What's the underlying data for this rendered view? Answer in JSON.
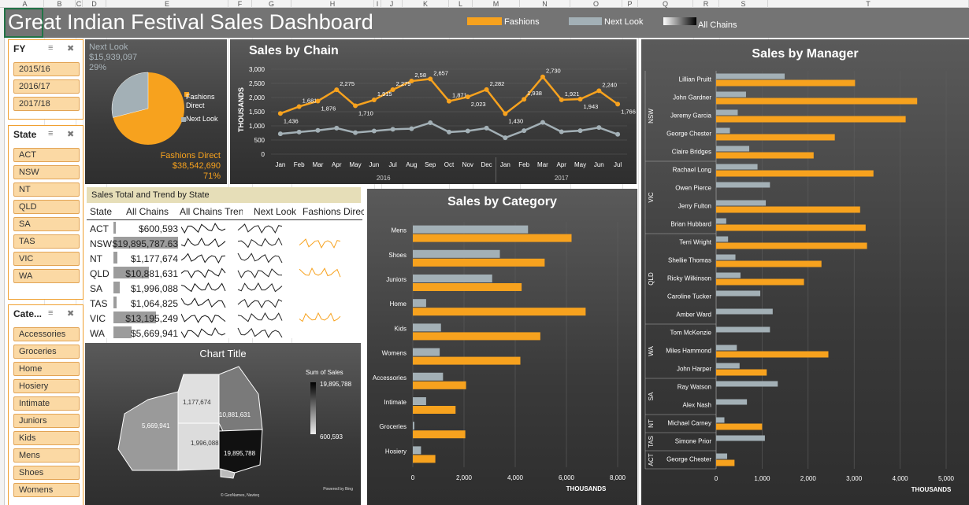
{
  "sheet": {
    "columns": [
      [
        "A",
        8,
        56
      ],
      [
        "B",
        56,
        96
      ],
      [
        "C",
        96,
        105
      ],
      [
        "D",
        105,
        135
      ],
      [
        "E",
        135,
        290
      ],
      [
        "F",
        290,
        320
      ],
      [
        "G",
        320,
        370
      ],
      [
        "H",
        370,
        475
      ],
      [
        "I",
        475,
        484
      ],
      [
        "J",
        484,
        511
      ],
      [
        "K",
        511,
        570
      ],
      [
        "L",
        570,
        600
      ],
      [
        "M",
        600,
        660
      ],
      [
        "N",
        660,
        724
      ],
      [
        "O",
        724,
        790
      ],
      [
        "P",
        790,
        810
      ],
      [
        "Q",
        810,
        880
      ],
      [
        "R",
        880,
        913
      ],
      [
        "S",
        913,
        975
      ],
      [
        "T",
        975,
        1230
      ]
    ]
  },
  "dashboard": {
    "title": "Great Indian Festival Sales Dashboard",
    "legend": [
      {
        "label": "Fashions",
        "color": "#f7a21e"
      },
      {
        "label": "Next Look",
        "color": "#a3b0b6"
      },
      {
        "label": "All Chains",
        "color": "#000000"
      }
    ]
  },
  "slicers": {
    "fy": {
      "title": "FY",
      "items": [
        "2015/16",
        "2016/17",
        "2017/18"
      ]
    },
    "state": {
      "title": "State",
      "items": [
        "ACT",
        "NSW",
        "NT",
        "QLD",
        "SA",
        "TAS",
        "VIC",
        "WA"
      ]
    },
    "category": {
      "title": "Cate...",
      "items": [
        "Accessories",
        "Groceries",
        "Home",
        "Hosiery",
        "Intimate",
        "Juniors",
        "Kids",
        "Mens",
        "Shoes",
        "Womens"
      ]
    }
  },
  "pie": {
    "next_look_label": "Next Look",
    "next_look_value": "$15,939,097",
    "next_look_pct": "29%",
    "fashions_label": "Fashions Direct",
    "fashions_value": "$38,542,690",
    "fashions_pct": "71%",
    "legend": [
      "Fashions Direct",
      "Next Look"
    ],
    "share": 0.29
  },
  "chain_chart": {
    "title": "Sales by Chain",
    "ylabel": "THOUSANDS",
    "yticks": [
      "3,000",
      "2,500",
      "2,000",
      "1,500",
      "1,000",
      "500",
      "0"
    ],
    "months": [
      "Jan",
      "Feb",
      "Mar",
      "Apr",
      "May",
      "Jun",
      "Jul",
      "Aug",
      "Sep",
      "Oct",
      "Nov",
      "Dec",
      "Jan",
      "Feb",
      "Mar",
      "Apr",
      "May",
      "Jun",
      "Jul"
    ],
    "years": [
      "2016",
      "2017"
    ],
    "fashions": [
      1436,
      1681,
      1876,
      2275,
      1710,
      1915,
      2279,
      2582,
      2657,
      1871,
      2023,
      2282,
      1430,
      1938,
      2730,
      1921,
      1943,
      2240,
      1766
    ],
    "labels": [
      "1,436",
      "1,681",
      "1,876",
      "2,275",
      "1,710",
      "1,915",
      "2,279",
      "2,58",
      "2,657",
      "1,871",
      "2,023",
      "2,282",
      "1,430",
      "1,938",
      "2,730",
      "1,921",
      "1,943",
      "2,240",
      "1,766"
    ],
    "nextlook": [
      720,
      780,
      840,
      920,
      760,
      820,
      880,
      900,
      1110,
      780,
      820,
      920,
      580,
      830,
      1120,
      790,
      830,
      940,
      700
    ]
  },
  "state_table": {
    "caption": "Sales Total and Trend by State",
    "headers": [
      "State",
      "All Chains",
      "All Chains Tren",
      "Next Look",
      "Fashions Direct"
    ],
    "rows": [
      {
        "state": "ACT",
        "value": "$600,593",
        "bar": 0.03,
        "fd": false
      },
      {
        "state": "NSW",
        "value": "$19,895,787.63",
        "bar": 1.0,
        "fd": true
      },
      {
        "state": "NT",
        "value": "$1,177,674",
        "bar": 0.06,
        "fd": false
      },
      {
        "state": "QLD",
        "value": "$10,881,631",
        "bar": 0.55,
        "fd": true
      },
      {
        "state": "SA",
        "value": "$1,996,088",
        "bar": 0.1,
        "fd": false
      },
      {
        "state": "TAS",
        "value": "$1,064,825",
        "bar": 0.05,
        "fd": false
      },
      {
        "state": "VIC",
        "value": "$13,195,249",
        "bar": 0.66,
        "fd": true
      },
      {
        "state": "WA",
        "value": "$5,669,941",
        "bar": 0.28,
        "fd": false
      }
    ]
  },
  "map": {
    "title": "Chart Title",
    "legend_title": "Sum of Sales",
    "max": "19,895,788",
    "min": "600,593",
    "labels": {
      "wa": "5,669,941",
      "nt": "1,177,674",
      "qld": "10,881,631",
      "sa": "1,996,088",
      "nsw": "19,895,788"
    },
    "credit1": "Powered by Bing",
    "credit2": "© GeoNames, Navteq"
  },
  "category_chart": {
    "title": "Sales by Category",
    "xlabel": "THOUSANDS",
    "xticks": [
      "0",
      "2,000",
      "4,000",
      "6,000",
      "8,000"
    ],
    "xmax": 8000,
    "categories": [
      "Mens",
      "Shoes",
      "Juniors",
      "Home",
      "Kids",
      "Womens",
      "Accessories",
      "Intimate",
      "Groceries",
      "Hosiery"
    ],
    "nextlook": [
      4500,
      3400,
      3100,
      520,
      1100,
      1050,
      1180,
      520,
      60,
      320
    ],
    "fashions": [
      6200,
      5150,
      4250,
      6750,
      4980,
      4200,
      2080,
      1670,
      2050,
      880
    ]
  },
  "manager_chart": {
    "title": "Sales by Manager",
    "xlabel": "THOUSANDS",
    "xticks": [
      "0",
      "1,000",
      "2,000",
      "3,000",
      "4,000",
      "5,000"
    ],
    "xmax": 5000,
    "groups": [
      {
        "state": "NSW",
        "managers": [
          {
            "name": "Lillian Pruitt",
            "nl": 1490,
            "fd": 3020
          },
          {
            "name": "John Gardner",
            "nl": 650,
            "fd": 4370
          },
          {
            "name": "Jeremy Garcia",
            "nl": 470,
            "fd": 4120
          },
          {
            "name": "George Chester",
            "nl": 300,
            "fd": 2580
          },
          {
            "name": "Claire Bridges",
            "nl": 720,
            "fd": 2120
          }
        ]
      },
      {
        "state": "VIC",
        "managers": [
          {
            "name": "Rachael Long",
            "nl": 900,
            "fd": 3420
          },
          {
            "name": "Owen Pierce",
            "nl": 1170,
            "fd": 0
          },
          {
            "name": "Jerry Fulton",
            "nl": 1080,
            "fd": 3130
          },
          {
            "name": "Brian Hubbard",
            "nl": 220,
            "fd": 3250
          }
        ]
      },
      {
        "state": "QLD",
        "managers": [
          {
            "name": "Terri Wright",
            "nl": 260,
            "fd": 3280
          },
          {
            "name": "Shellie Thomas",
            "nl": 420,
            "fd": 2290
          },
          {
            "name": "Ricky Wilkinson",
            "nl": 530,
            "fd": 1910
          },
          {
            "name": "Caroline Tucker",
            "nl": 960,
            "fd": 0
          },
          {
            "name": "Amber Ward",
            "nl": 1230,
            "fd": 0
          }
        ]
      },
      {
        "state": "WA",
        "managers": [
          {
            "name": "Tom McKenzie",
            "nl": 1170,
            "fd": 0
          },
          {
            "name": "Miles Hammond",
            "nl": 450,
            "fd": 2440
          },
          {
            "name": "John Harper",
            "nl": 510,
            "fd": 1100
          }
        ]
      },
      {
        "state": "SA",
        "managers": [
          {
            "name": "Ray Watson",
            "nl": 1340,
            "fd": 0
          },
          {
            "name": "Alex Nash",
            "nl": 670,
            "fd": 0
          }
        ]
      },
      {
        "state": "NT",
        "managers": [
          {
            "name": "Michael Carney",
            "nl": 180,
            "fd": 1000
          }
        ]
      },
      {
        "state": "TAS",
        "managers": [
          {
            "name": "Simone Prior",
            "nl": 1060,
            "fd": 0
          }
        ]
      },
      {
        "state": "ACT",
        "managers": [
          {
            "name": "George Chester",
            "nl": 240,
            "fd": 400
          }
        ]
      }
    ]
  }
}
